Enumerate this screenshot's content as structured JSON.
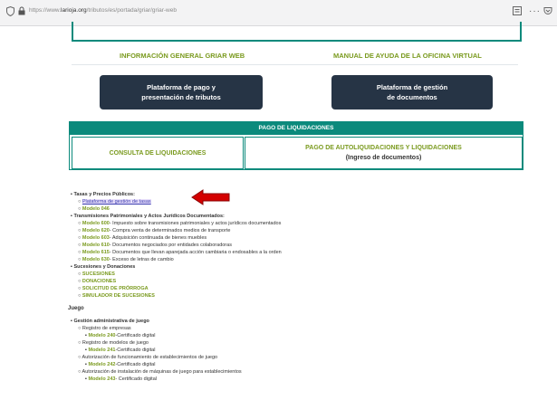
{
  "browser": {
    "url_prefix": "https://www.",
    "url_host": "larioja.org",
    "url_rest": "/tributos/es/portada/griar/griar-web"
  },
  "top_links": {
    "info": "INFORMACIÓN GENERAL GRIAR WEB",
    "manual": "MANUAL DE AYUDA DE LA OFICINA VIRTUAL"
  },
  "buttons": {
    "pago": [
      "Plataforma de pago y",
      "presentación de tributos"
    ],
    "gestion": [
      "Plataforma de gestión",
      "de documentos"
    ]
  },
  "liquidaciones": {
    "header": "PAGO DE LIQUIDACIONES",
    "consulta": "CONSULTA DE LIQUIDACIONES",
    "pago_auto": "PAGO DE AUTOLIQUIDACIONES Y LIQUIDACIONES",
    "ingreso": "(Ingreso de documentos)"
  },
  "tasas": {
    "heading": "Tasas y Precios Públicos:",
    "items": [
      {
        "code": "Plataforma de gestión de tasas",
        "desc": ""
      },
      {
        "code": "Modelo 046",
        "desc": ""
      }
    ]
  },
  "transmisiones": {
    "heading": "Transmisiones Patrimoniales y Actos Jurídicos Documentados:",
    "items": [
      {
        "code": "Modelo 600",
        "desc": "- Impuesto sobre transmisiones patrimoniales y actos jurídicos documentados"
      },
      {
        "code": "Modelo 620",
        "desc": "- Compra venta de determinados medios de transporte"
      },
      {
        "code": "Modelo 603",
        "desc": "- Adquisición continuada de bienes muebles"
      },
      {
        "code": "Modelo 610",
        "desc": "- Documentos negociados por entidades colaboradoras"
      },
      {
        "code": "Modelo 615",
        "desc": "- Documentos que llevan aparejada acción cambiaria o endosables a la orden"
      },
      {
        "code": "Modelo 630",
        "desc": "- Exceso de letras de cambio"
      }
    ]
  },
  "sucesiones": {
    "heading": "Sucesiones y Donaciones",
    "items": [
      "SUCESIONES",
      "DONACIONES",
      "SOLICITUD DE PRÓRROGA",
      "SIMULADOR DE SUCESIONES"
    ]
  },
  "juego": {
    "title": "Juego",
    "gestion": "Gestión administrativa de juego",
    "groups": [
      {
        "label": "Registro de empresas",
        "code": "Modelo 240",
        "desc": "-Certificado digital"
      },
      {
        "label": "Registro de modelos de juego",
        "code": "Modelo 241",
        "desc": "-Certificado digital"
      },
      {
        "label": "Autorización de funcionamiento de establecimientos de juego",
        "code": "Modelo 242",
        "desc": "-Certificado digital"
      },
      {
        "label": "Autorización de instalación de máquinas de juego para establecimientos",
        "code": "Modelo 243",
        "desc": "- Certificado digital"
      }
    ]
  },
  "colors": {
    "teal": "#0b8a7c",
    "green_link": "#7a9a1e",
    "dark_button": "#263445",
    "arrow": "#d40000"
  }
}
